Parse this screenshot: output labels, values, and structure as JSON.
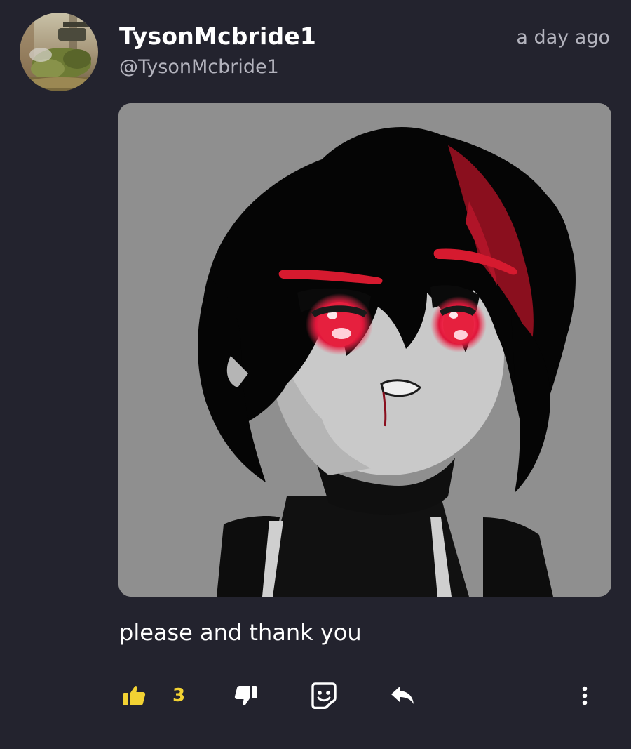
{
  "post": {
    "username": "TysonMcbride1",
    "handle": "@TysonMcbride1",
    "timestamp": "a day ago",
    "comment": "please and thank you",
    "likes": "3"
  },
  "icons": {
    "like": "thumbs-up-icon",
    "dislike": "thumbs-down-icon",
    "sticker": "sticker-icon",
    "reply": "reply-icon",
    "more": "more-vertical-icon"
  },
  "colors": {
    "background": "#23232e",
    "like_active": "#f2d233",
    "secondary_text": "#b3b3bd",
    "image_background": "#8f8f8f"
  }
}
